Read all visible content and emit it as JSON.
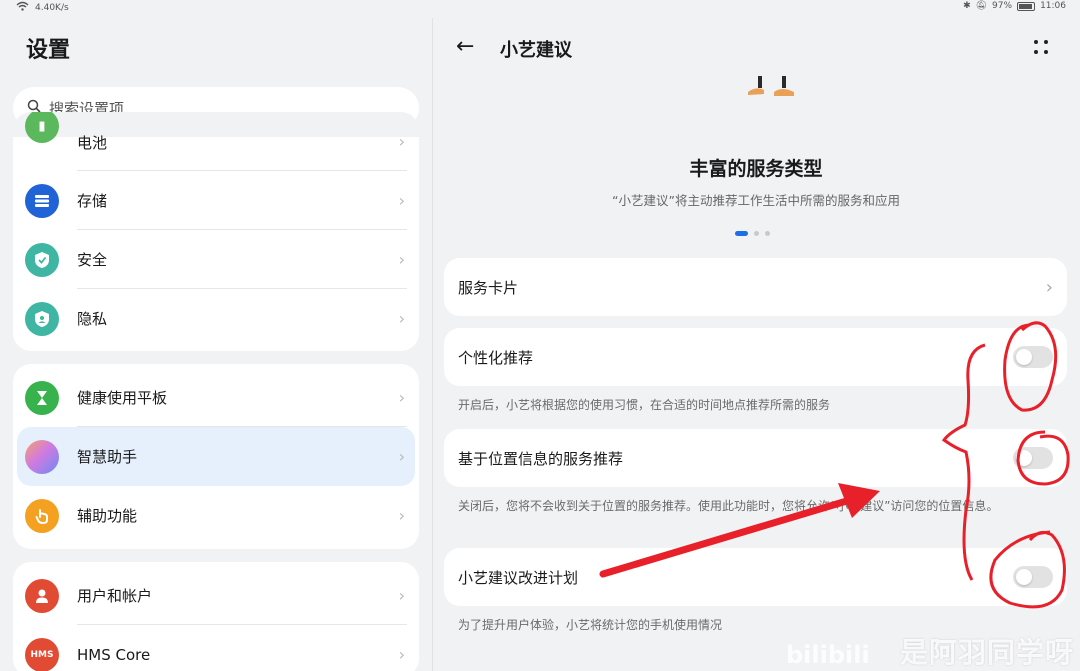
{
  "status_bar": {
    "speed": "4.40K/s",
    "battery": "97%",
    "time": "11:06"
  },
  "left": {
    "title": "设置",
    "search": {
      "placeholder": "搜索设置项"
    },
    "group1": [
      {
        "label": "电池",
        "icon": "battery-icon",
        "color": "#5cb85c"
      },
      {
        "label": "存储",
        "icon": "storage-icon",
        "color": "#1f63d6"
      },
      {
        "label": "安全",
        "icon": "shield-icon",
        "color": "#3fb6a3"
      },
      {
        "label": "隐私",
        "icon": "privacy-shield-icon",
        "color": "#3fb6a3"
      }
    ],
    "group2": [
      {
        "label": "健康使用平板",
        "icon": "hourglass-icon",
        "color": "#37b24d"
      },
      {
        "label": "智慧助手",
        "icon": "assistant-orb-icon",
        "color": "#c87ad9"
      },
      {
        "label": "辅助功能",
        "icon": "hand-icon",
        "color": "#f4a020"
      }
    ],
    "group3": [
      {
        "label": "用户和帐户",
        "icon": "user-icon",
        "color": "#e14a33"
      },
      {
        "label": "HMS Core",
        "icon": "hms-icon",
        "color": "#e14a33",
        "badge": "HMS"
      }
    ]
  },
  "right": {
    "title": "小艺建议",
    "headline": "丰富的服务类型",
    "subline": "“小艺建议”将主动推荐工作生活中所需的服务和应用",
    "service_card": "服务卡片",
    "settings": [
      {
        "label": "个性化推荐",
        "desc": "开启后，小艺将根据您的使用习惯，在合适的时间地点推荐所需的服务",
        "on": false
      },
      {
        "label": "基于位置信息的服务推荐",
        "desc": "关闭后，您将不会收到关于位置的服务推荐。使用此功能时，您将允许“小艺建议”访问您的位置信息。",
        "on": false
      },
      {
        "label": "小艺建议改进计划",
        "desc": "为了提升用户体验，小艺将统计您的手机使用情况",
        "on": false
      }
    ]
  },
  "watermark": {
    "text": "是阿羽同学呀"
  },
  "colors": {
    "accent": "#1e6ee8",
    "annotation": "#e8202a"
  }
}
